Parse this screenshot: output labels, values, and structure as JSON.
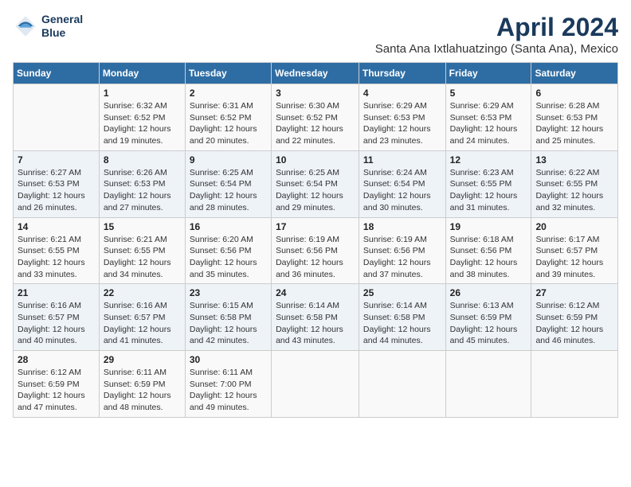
{
  "header": {
    "logo_line1": "General",
    "logo_line2": "Blue",
    "month_title": "April 2024",
    "subtitle": "Santa Ana Ixtlahuatzingo (Santa Ana), Mexico"
  },
  "columns": [
    "Sunday",
    "Monday",
    "Tuesday",
    "Wednesday",
    "Thursday",
    "Friday",
    "Saturday"
  ],
  "weeks": [
    [
      {
        "day": "",
        "info": ""
      },
      {
        "day": "1",
        "info": "Sunrise: 6:32 AM\nSunset: 6:52 PM\nDaylight: 12 hours\nand 19 minutes."
      },
      {
        "day": "2",
        "info": "Sunrise: 6:31 AM\nSunset: 6:52 PM\nDaylight: 12 hours\nand 20 minutes."
      },
      {
        "day": "3",
        "info": "Sunrise: 6:30 AM\nSunset: 6:52 PM\nDaylight: 12 hours\nand 22 minutes."
      },
      {
        "day": "4",
        "info": "Sunrise: 6:29 AM\nSunset: 6:53 PM\nDaylight: 12 hours\nand 23 minutes."
      },
      {
        "day": "5",
        "info": "Sunrise: 6:29 AM\nSunset: 6:53 PM\nDaylight: 12 hours\nand 24 minutes."
      },
      {
        "day": "6",
        "info": "Sunrise: 6:28 AM\nSunset: 6:53 PM\nDaylight: 12 hours\nand 25 minutes."
      }
    ],
    [
      {
        "day": "7",
        "info": "Sunrise: 6:27 AM\nSunset: 6:53 PM\nDaylight: 12 hours\nand 26 minutes."
      },
      {
        "day": "8",
        "info": "Sunrise: 6:26 AM\nSunset: 6:53 PM\nDaylight: 12 hours\nand 27 minutes."
      },
      {
        "day": "9",
        "info": "Sunrise: 6:25 AM\nSunset: 6:54 PM\nDaylight: 12 hours\nand 28 minutes."
      },
      {
        "day": "10",
        "info": "Sunrise: 6:25 AM\nSunset: 6:54 PM\nDaylight: 12 hours\nand 29 minutes."
      },
      {
        "day": "11",
        "info": "Sunrise: 6:24 AM\nSunset: 6:54 PM\nDaylight: 12 hours\nand 30 minutes."
      },
      {
        "day": "12",
        "info": "Sunrise: 6:23 AM\nSunset: 6:55 PM\nDaylight: 12 hours\nand 31 minutes."
      },
      {
        "day": "13",
        "info": "Sunrise: 6:22 AM\nSunset: 6:55 PM\nDaylight: 12 hours\nand 32 minutes."
      }
    ],
    [
      {
        "day": "14",
        "info": "Sunrise: 6:21 AM\nSunset: 6:55 PM\nDaylight: 12 hours\nand 33 minutes."
      },
      {
        "day": "15",
        "info": "Sunrise: 6:21 AM\nSunset: 6:55 PM\nDaylight: 12 hours\nand 34 minutes."
      },
      {
        "day": "16",
        "info": "Sunrise: 6:20 AM\nSunset: 6:56 PM\nDaylight: 12 hours\nand 35 minutes."
      },
      {
        "day": "17",
        "info": "Sunrise: 6:19 AM\nSunset: 6:56 PM\nDaylight: 12 hours\nand 36 minutes."
      },
      {
        "day": "18",
        "info": "Sunrise: 6:19 AM\nSunset: 6:56 PM\nDaylight: 12 hours\nand 37 minutes."
      },
      {
        "day": "19",
        "info": "Sunrise: 6:18 AM\nSunset: 6:56 PM\nDaylight: 12 hours\nand 38 minutes."
      },
      {
        "day": "20",
        "info": "Sunrise: 6:17 AM\nSunset: 6:57 PM\nDaylight: 12 hours\nand 39 minutes."
      }
    ],
    [
      {
        "day": "21",
        "info": "Sunrise: 6:16 AM\nSunset: 6:57 PM\nDaylight: 12 hours\nand 40 minutes."
      },
      {
        "day": "22",
        "info": "Sunrise: 6:16 AM\nSunset: 6:57 PM\nDaylight: 12 hours\nand 41 minutes."
      },
      {
        "day": "23",
        "info": "Sunrise: 6:15 AM\nSunset: 6:58 PM\nDaylight: 12 hours\nand 42 minutes."
      },
      {
        "day": "24",
        "info": "Sunrise: 6:14 AM\nSunset: 6:58 PM\nDaylight: 12 hours\nand 43 minutes."
      },
      {
        "day": "25",
        "info": "Sunrise: 6:14 AM\nSunset: 6:58 PM\nDaylight: 12 hours\nand 44 minutes."
      },
      {
        "day": "26",
        "info": "Sunrise: 6:13 AM\nSunset: 6:59 PM\nDaylight: 12 hours\nand 45 minutes."
      },
      {
        "day": "27",
        "info": "Sunrise: 6:12 AM\nSunset: 6:59 PM\nDaylight: 12 hours\nand 46 minutes."
      }
    ],
    [
      {
        "day": "28",
        "info": "Sunrise: 6:12 AM\nSunset: 6:59 PM\nDaylight: 12 hours\nand 47 minutes."
      },
      {
        "day": "29",
        "info": "Sunrise: 6:11 AM\nSunset: 6:59 PM\nDaylight: 12 hours\nand 48 minutes."
      },
      {
        "day": "30",
        "info": "Sunrise: 6:11 AM\nSunset: 7:00 PM\nDaylight: 12 hours\nand 49 minutes."
      },
      {
        "day": "",
        "info": ""
      },
      {
        "day": "",
        "info": ""
      },
      {
        "day": "",
        "info": ""
      },
      {
        "day": "",
        "info": ""
      }
    ]
  ]
}
